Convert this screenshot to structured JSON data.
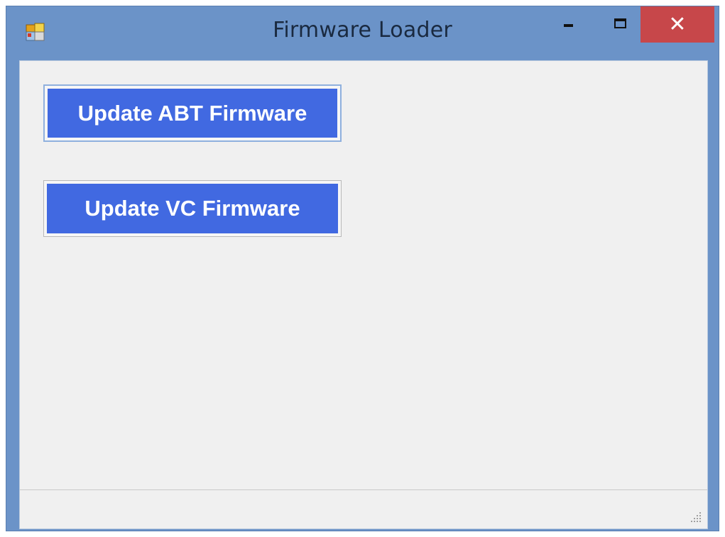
{
  "window": {
    "title": "Firmware Loader",
    "close_label": "✕",
    "icons": {
      "app": "app-window-icon",
      "minimize": "minimize-icon",
      "maximize": "maximize-icon",
      "close": "close-icon",
      "grip": "resize-grip-icon"
    },
    "colors": {
      "frame": "#6b93c8",
      "close": "#c7474a",
      "client": "#f0f0f0"
    }
  },
  "buttons": {
    "update_abt": "Update ABT Firmware",
    "update_vc": "Update VC Firmware",
    "color": "#4169e1"
  }
}
